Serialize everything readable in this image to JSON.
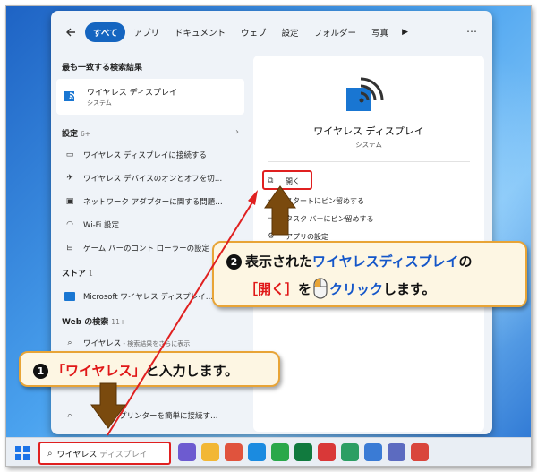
{
  "search_panel": {
    "filters": [
      "すべて",
      "アプリ",
      "ドキュメント",
      "ウェブ",
      "設定",
      "フォルダー",
      "写真"
    ],
    "best_match": {
      "header": "最も一致する検索結果",
      "title": "ワイヤレス ディスプレイ",
      "subtitle": "システム"
    },
    "settings_section": {
      "header": "設定",
      "count": "6+"
    },
    "settings_items": [
      "ワイヤレス ディスプレイに接続する",
      "ワイヤレス デバイスのオンとオフを切…",
      "ネットワーク アダプターに関する問題…",
      "Wi-Fi 設定",
      "ゲーム バーのコント ローラーの設定"
    ],
    "store_section": {
      "header": "ストア",
      "count": "1"
    },
    "store_items": [
      "Microsoft ワイヤレス ディスプレイ…"
    ],
    "web_section": {
      "header": "Web の検索",
      "count": "11+"
    },
    "web_items": [
      {
        "text": "ワイヤレス",
        "sub": " - 検索結果をさらに表示"
      },
      {
        "text": "プリンターを簡単に接続す…",
        "sub": ""
      }
    ],
    "detail": {
      "title": "ワイヤレス ディスプレイ",
      "subtitle": "システム",
      "actions": [
        "開く",
        "スタートにピン留めする",
        "タスク バーにピン留めする",
        "アプリの設定"
      ]
    }
  },
  "taskbar": {
    "search_typed": "ワイヤレス",
    "search_suggestion": "ディスプレイ",
    "app_colors": [
      "#6d5bd0",
      "#f2b735",
      "#e0533d",
      "#1b8be0",
      "#2aa84a",
      "#117a3e",
      "#d93838",
      "#2c9e63",
      "#3a7bd5",
      "#5c6bc0",
      "#d9463c"
    ]
  },
  "callouts": {
    "step1": {
      "num": "1",
      "quoted": "「ワイヤレス」",
      "rest": "と入力します。"
    },
    "step2": {
      "num": "2",
      "line1_pre": "表示された",
      "line1_blue": "ワイヤレスディスプレイ",
      "line1_post": "の",
      "line2_red": "［開く］",
      "line2_mid": "を",
      "line2_click": "クリック",
      "line2_post": "します。"
    }
  },
  "colors": {
    "accent_blue": "#1565c0",
    "highlight_red": "#e02020",
    "callout_border": "#e8a436",
    "callout_bg": "#fdf6e3",
    "arrow_brown": "#7a4a0e"
  }
}
